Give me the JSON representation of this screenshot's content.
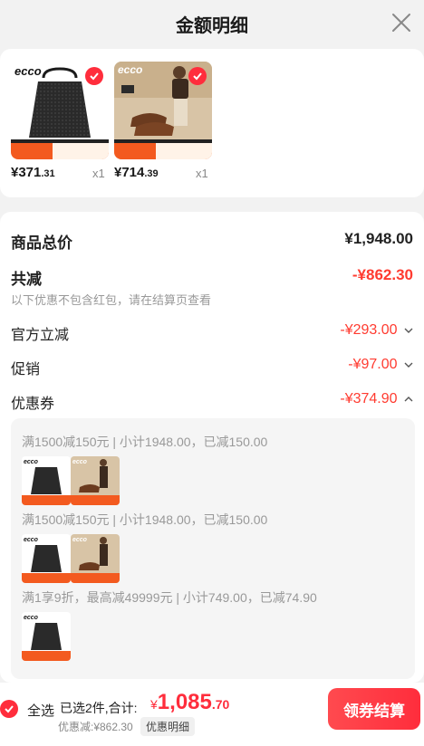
{
  "header": {
    "title": "金额明细",
    "close_icon": "close-icon"
  },
  "products": [
    {
      "brand": "ecco",
      "price_int": "¥371",
      "price_dec": ".31",
      "qty": "x1",
      "image": "black-tote-bag"
    },
    {
      "brand": "ecco",
      "price_int": "¥714",
      "price_dec": ".39",
      "qty": "x1",
      "image": "brown-leather-shoes-model"
    }
  ],
  "summary": {
    "goods_total_label": "商品总价",
    "goods_total_value": "¥1,948.00",
    "reduction_label": "共减",
    "reduction_value": "-¥862.30",
    "reduction_note": "以下优惠不包含红包，请在结算页查看",
    "official_label": "官方立减",
    "official_value": "-¥293.00",
    "promo_label": "促销",
    "promo_value": "-¥97.00",
    "coupon_label": "优惠券",
    "coupon_value": "-¥374.90"
  },
  "coupons": [
    {
      "text": "满1500减150元 | 小计1948.00，已减150.00",
      "items": [
        "black-tote-bag",
        "brown-leather-shoes-model"
      ]
    },
    {
      "text": "满1500减150元 | 小计1948.00，已减150.00",
      "items": [
        "black-tote-bag",
        "brown-leather-shoes-model"
      ]
    },
    {
      "text": "满1享9折，最高减49999元 | 小计749.00，已减74.90",
      "items": [
        "black-tote-bag"
      ]
    }
  ],
  "bottom": {
    "select_all": "全选",
    "selected_text": "已选2件,合计:",
    "total_currency": "¥",
    "total_int": "1,085",
    "total_dec": ".70",
    "discount_text": "优惠减:¥862.30",
    "detail_tag": "优惠明细",
    "checkout_button": "领券结算"
  },
  "colors": {
    "accent": "#ff2d3c",
    "background": "#f2f2f2"
  }
}
